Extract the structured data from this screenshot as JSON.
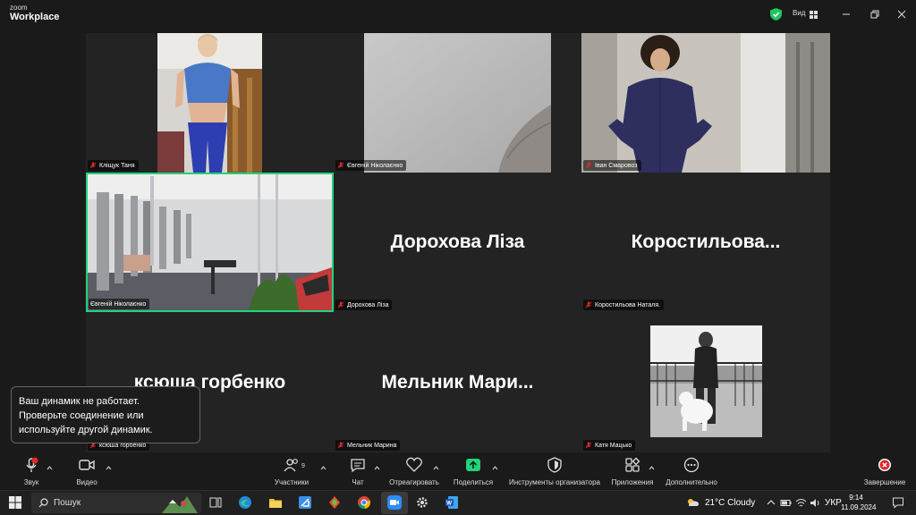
{
  "app": {
    "logo_line1": "zoom",
    "logo_line2": "Workplace",
    "view_label": "Вид"
  },
  "gallery": {
    "tiles": [
      {
        "name": "Кліщук Таня",
        "display": ""
      },
      {
        "name": "Євгеній Ніколаєнко",
        "display": ""
      },
      {
        "name": "Іван Смаровоз",
        "display": ""
      },
      {
        "name": "Євгеній Ніколаєнко",
        "display": ""
      },
      {
        "name": "Дорохова Ліза",
        "display": "Дорохова Ліза"
      },
      {
        "name": "Коростильова Наталя.",
        "display": "Коростильова..."
      },
      {
        "name": "ксюша горбенко",
        "display": "ксюша горбенко"
      },
      {
        "name": "Мельник Марина",
        "display": "Мельник  Мари..."
      },
      {
        "name": "Катя Мацько",
        "display": ""
      }
    ]
  },
  "notice": {
    "line1": "Ваш динамик не работает.",
    "line2": "Проверьте соединение или",
    "line3": "используйте другой динамик."
  },
  "toolbar": {
    "audio": "Звук",
    "video": "Видео",
    "participants": "Участники",
    "participants_count": "9",
    "chat": "Чат",
    "react": "Отреагировать",
    "share": "Поделиться",
    "host_tools": "Инструменты организатора",
    "apps": "Приложения",
    "more": "Дополнительно",
    "end": "Завершение"
  },
  "taskbar": {
    "search_placeholder": "Пошук",
    "weather": "21°C  Cloudy",
    "language": "УКР",
    "time": "9:14",
    "date": "11.09.2024"
  },
  "colors": {
    "active_speaker": "#22d37a",
    "share_green": "#22d37a",
    "end_red": "#e02828",
    "muted_red": "#e02828"
  }
}
